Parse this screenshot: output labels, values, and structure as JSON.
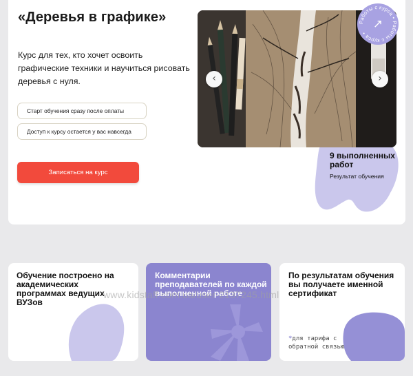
{
  "hero": {
    "title": "«Деревья в графике»",
    "description": "Курс для тех, кто хочет освоить графические техники и научиться рисовать деревья с нуля.",
    "pills": [
      "Старт обучения сразу после оплаты",
      "Доступ к курсу остается у вас навсегда"
    ],
    "cta_label": "Записаться на курс",
    "carousel": {
      "prev_icon": "chevron-left-icon",
      "next_icon": "chevron-right-icon",
      "prev_glyph": "‹",
      "next_glyph": "›",
      "image": "pencil drawing of birch tree with pencils"
    },
    "badge": {
      "text": "Работы с курса • Работы с курса • ",
      "icon": "arrow-up-right-icon",
      "glyph": "↗"
    },
    "stat": {
      "value": "9 выполненных работ",
      "caption": "Результат обучения"
    }
  },
  "features": [
    {
      "text": "Обучение построено на академических программах ведущих ВУЗов"
    },
    {
      "text": "Комментарии преподавателей по каждой выполненной работе"
    },
    {
      "text": "По результатам обучения вы получаете именной сертификат",
      "note_star": "*",
      "note": "для тарифа с обратной связью"
    }
  ],
  "watermark": "www.kidstaff.com.ua/user-2137245.html",
  "colors": {
    "accent_red": "#f24a3c",
    "lavender": "#8b85cf",
    "light_lavender": "#cac7ec",
    "background": "#e9e9eb"
  }
}
